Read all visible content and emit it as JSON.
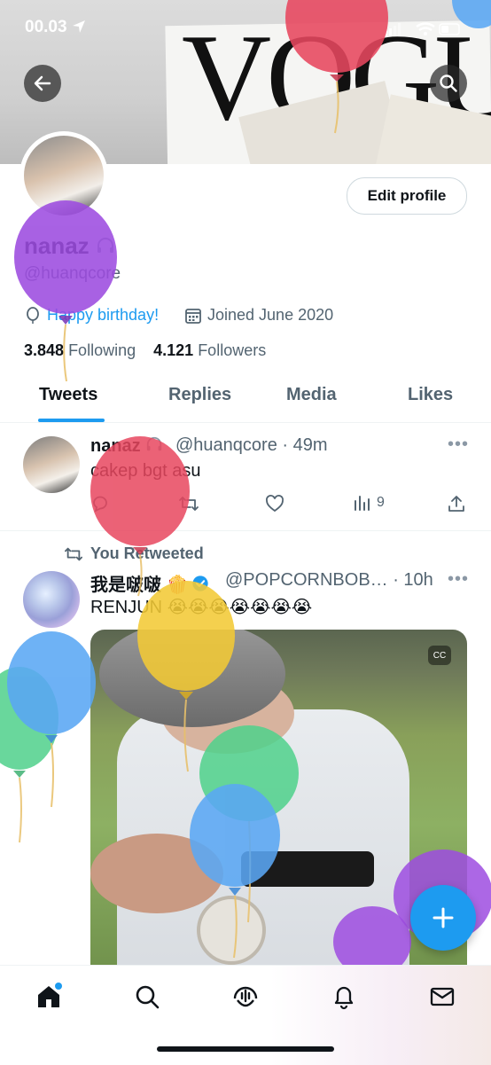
{
  "status_bar": {
    "time": "00.03"
  },
  "banner": {
    "magazine_text": "VOGUE"
  },
  "profile": {
    "edit_button": "Edit profile",
    "display_name": "nanaz",
    "handle": "@huanqcore",
    "birthday": "Happy birthday!",
    "joined": "Joined June 2020",
    "following_count": "3.848",
    "following_label": "Following",
    "followers_count": "4.121",
    "followers_label": "Followers"
  },
  "tabs": [
    {
      "label": "Tweets",
      "selected": true
    },
    {
      "label": "Replies",
      "selected": false
    },
    {
      "label": "Media",
      "selected": false
    },
    {
      "label": "Likes",
      "selected": false
    }
  ],
  "tweets": [
    {
      "name": "nanaz",
      "meta": "@huanqcore · 49m",
      "text": "cakep bgt asu",
      "views": "9"
    },
    {
      "retweet_label": "You Retweeted",
      "name": "我是啵啵 🍿",
      "meta": "@POPCORNBOB… · 10h",
      "text": "RENJUN 😭😭😭😭😭😭😭",
      "verified": true
    }
  ],
  "colors": {
    "accent": "#1d9bf0",
    "text": "#0f1419",
    "muted": "#536471"
  },
  "icons": [
    "back-arrow-icon",
    "search-icon",
    "balloon-icon",
    "calendar-icon",
    "reply-icon",
    "retweet-icon",
    "like-icon",
    "views-icon",
    "share-icon",
    "more-icon",
    "compose-plus-icon",
    "home-icon",
    "explore-icon",
    "spaces-icon",
    "notifications-icon",
    "messages-icon"
  ]
}
